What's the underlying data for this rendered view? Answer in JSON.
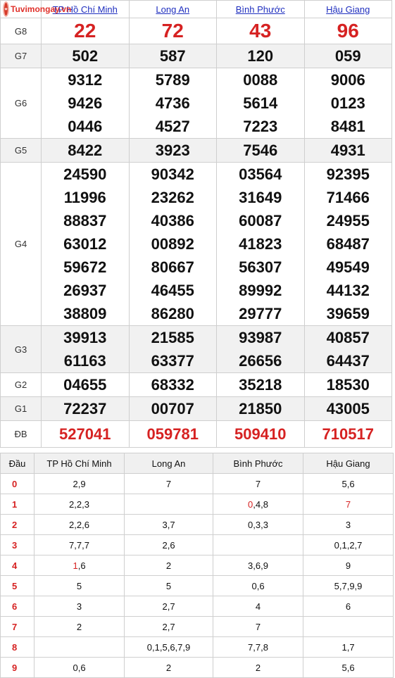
{
  "logo": {
    "text": "Tuvimongay.vn"
  },
  "provinces": [
    "TP Hồ Chí Minh",
    "Long An",
    "Bình Phước",
    "Hậu Giang"
  ],
  "prizes": [
    {
      "label": "G8",
      "rows": [
        [
          "22",
          "72",
          "43",
          "96"
        ]
      ]
    },
    {
      "label": "G7",
      "rows": [
        [
          "502",
          "587",
          "120",
          "059"
        ]
      ]
    },
    {
      "label": "G6",
      "rows": [
        [
          "9312",
          "5789",
          "0088",
          "9006"
        ],
        [
          "9426",
          "4736",
          "5614",
          "0123"
        ],
        [
          "0446",
          "4527",
          "7223",
          "8481"
        ]
      ]
    },
    {
      "label": "G5",
      "rows": [
        [
          "8422",
          "3923",
          "7546",
          "4931"
        ]
      ]
    },
    {
      "label": "G4",
      "rows": [
        [
          "24590",
          "90342",
          "03564",
          "92395"
        ],
        [
          "11996",
          "23262",
          "31649",
          "71466"
        ],
        [
          "88837",
          "40386",
          "60087",
          "24955"
        ],
        [
          "63012",
          "00892",
          "41823",
          "68487"
        ],
        [
          "59672",
          "80667",
          "56307",
          "49549"
        ],
        [
          "26937",
          "46455",
          "89992",
          "44132"
        ],
        [
          "38809",
          "86280",
          "29777",
          "39659"
        ]
      ]
    },
    {
      "label": "G3",
      "rows": [
        [
          "39913",
          "21585",
          "93987",
          "40857"
        ],
        [
          "61163",
          "63377",
          "26656",
          "64437"
        ]
      ]
    },
    {
      "label": "G2",
      "rows": [
        [
          "04655",
          "68332",
          "35218",
          "18530"
        ]
      ]
    },
    {
      "label": "G1",
      "rows": [
        [
          "72237",
          "00707",
          "21850",
          "43005"
        ]
      ]
    },
    {
      "label": "ĐB",
      "rows": [
        [
          "527041",
          "059781",
          "509410",
          "710517"
        ]
      ]
    }
  ],
  "loto": {
    "header": [
      "Đầu",
      "TP Hồ Chí Minh",
      "Long An",
      "Bình Phước",
      "Hậu Giang"
    ],
    "rows": [
      [
        "0",
        "2,9",
        "7",
        "7",
        "5,6"
      ],
      [
        "1",
        "2,2,3",
        "",
        "0,4,8",
        "7"
      ],
      [
        "2",
        "2,2,6",
        "3,7",
        "0,3,3",
        "3"
      ],
      [
        "3",
        "7,7,7",
        "2,6",
        "",
        "0,1,2,7"
      ],
      [
        "4",
        "1,6",
        "2",
        "3,6,9",
        "9"
      ],
      [
        "5",
        "5",
        "5",
        "0,6",
        "5,7,9,9"
      ],
      [
        "6",
        "3",
        "2,7",
        "4",
        "6"
      ],
      [
        "7",
        "2",
        "2,7",
        "7",
        ""
      ],
      [
        "8",
        "",
        "0,1,5,6,7,9",
        "7,7,8",
        "1,7"
      ],
      [
        "9",
        "0,6",
        "2",
        "2",
        "5,6"
      ]
    ],
    "highlight_color": "#d62222"
  }
}
